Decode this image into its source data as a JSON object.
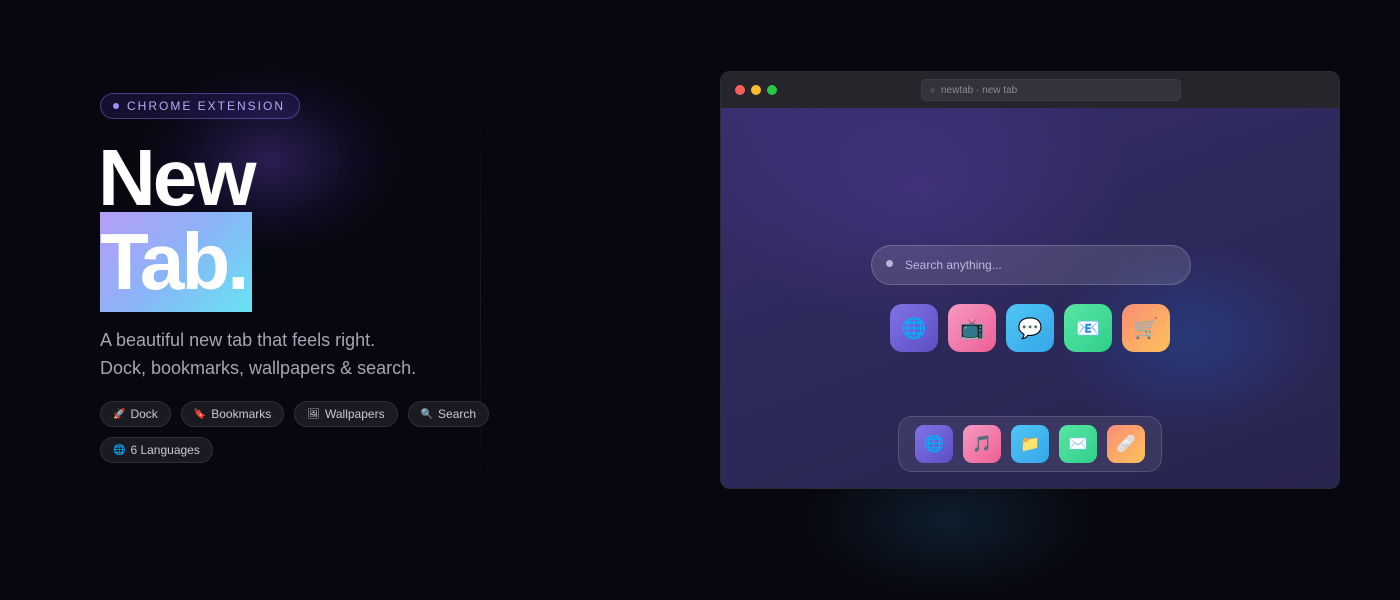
{
  "hero": {
    "badge": "CHROME EXTENSION",
    "title_line1": "New",
    "title_line2": "Tab.",
    "subtitle_line1": "A beautiful new tab that feels right.",
    "subtitle_line2": "Dock, bookmarks, wallpapers & search."
  },
  "features": [
    {
      "icon": "🚀",
      "icon_name": "rocket-icon",
      "label": "Dock"
    },
    {
      "icon": "🔖",
      "icon_name": "bookmark-icon",
      "label": "Bookmarks"
    },
    {
      "icon": "🖼",
      "icon_name": "wallpaper-icon",
      "label": "Wallpapers"
    },
    {
      "icon": "🔍",
      "icon_name": "search-icon",
      "label": "Search"
    },
    {
      "icon": "🌐",
      "icon_name": "globe-icon",
      "label": "6 Languages"
    }
  ],
  "browser": {
    "url": "newtab · new tab",
    "search_placeholder": "Search anything...",
    "apps": [
      {
        "icon": "🌐",
        "icon_name": "globe-icon"
      },
      {
        "icon": "📺",
        "icon_name": "tv-icon"
      },
      {
        "icon": "💬",
        "icon_name": "chat-icon"
      },
      {
        "icon": "📧",
        "icon_name": "mail-icon"
      },
      {
        "icon": "🛒",
        "icon_name": "cart-icon"
      }
    ],
    "dock": [
      {
        "icon": "🌐",
        "icon_name": "globe-icon"
      },
      {
        "icon": "🎵",
        "icon_name": "music-icon"
      },
      {
        "icon": "📁",
        "icon_name": "folder-icon"
      },
      {
        "icon": "✉️",
        "icon_name": "envelope-icon"
      },
      {
        "icon": "🩹",
        "icon_name": "bandage-icon"
      }
    ]
  },
  "colors": {
    "accent_purple": "#a78bfa",
    "gradient_start": "#b69cf7",
    "gradient_end": "#67e3f2",
    "background": "#07070f"
  }
}
